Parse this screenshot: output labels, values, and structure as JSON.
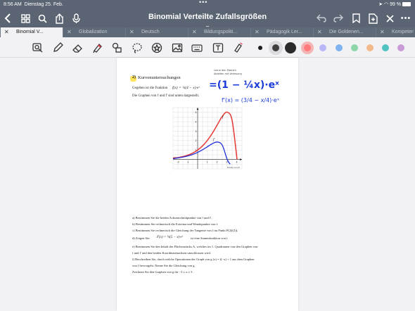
{
  "status": {
    "time": "8:56 AM",
    "date": "Dienstag 25. Feb.",
    "battery": "99 %"
  },
  "title_bar": {
    "document_title": "Binomial Verteilte Zufallsgrößen",
    "chevron": "chevron-down-icon"
  },
  "tabs": [
    {
      "label": "Binomial V...",
      "active": true
    },
    {
      "label": "Globalization",
      "active": false
    },
    {
      "label": "Deutsch",
      "active": false
    },
    {
      "label": "Bildungspoliti...",
      "active": false
    },
    {
      "label": "Pädagogik Ler...",
      "active": false
    },
    {
      "label": "Die Goldenen...",
      "active": false
    },
    {
      "label": "Kompeten...",
      "active": false
    }
  ],
  "pen_colors": [
    "#1c1c1e",
    "#404040",
    "#2b2b2b",
    "#ff7a7a",
    "#b9b7f5",
    "#7fb2f0",
    "#8ed6a8",
    "#f4b98a",
    "#4fc2c2",
    "#c89bd6"
  ],
  "page": {
    "task_number": "2)",
    "task_title": "Kurvenuntersuchungen",
    "margin_note_line1": "Lerne den Ebenen",
    "margin_note_line2": "Ableiten mit Vorlesung",
    "given_text": "Gegeben ist die Funktion",
    "function_def": "f(x) = ¼(4 − x)·eˣ",
    "handwritten_rewrite": "=(1 − ¼x)·eˣ",
    "graphs_text": "Die Graphen von f und f' sind unten dargestellt.",
    "handwritten_derivative": "f'(x) = (3/4 − x/4)·eˣ",
    "graph_label_f": "f",
    "graph_label_fprime": "f'",
    "x_ticks": [
      "-2",
      "-1",
      "1",
      "2",
      "3",
      "4"
    ],
    "y_ticks": [
      "5",
      "4",
      "3",
      "2",
      "1"
    ],
    "graph_caption": "Moodle.com.pdf",
    "tasks": [
      "a) Bestimmen Sie die beiden Achsenschnittpunkte von f und f'.",
      "b) Bestimmen Sie rechnerisch die Extrema und Wendepunkte von f.",
      "c) Bestimmen Sie rechnerisch die Gleichung der Tangente von f im Punkt P(2|f(2)).",
      "d) Zeigen Sie:",
      "e) Bestimmen Sie den Inhalt des Flächenstücks A, welches im 1. Quadranten von den Graphen von",
      "f und f' und den beiden Koordinatenachsen umschlossen wird.",
      "f) Beschreiben Sie, durch welche Operationen der Graph von g (x) = f(−x) + 1 aus dem Graphen",
      "von f hervorgeht. Nenne Sie die Gleichung von g.",
      "Zeichnen Sie den Graphen von g für   −3 ≤ x ≤ 3 ."
    ],
    "d_formula": "F(x) = ¼(5 − x)·eˣ",
    "d_suffix": "ist eine Stammfunktion von f."
  },
  "chart_data": {
    "type": "line",
    "title": "",
    "xlabel": "",
    "ylabel": "",
    "xlim": [
      -2.5,
      4.5
    ],
    "ylim": [
      -1,
      5.5
    ],
    "grid": true,
    "series": [
      {
        "name": "f",
        "color": "#e53935",
        "x": [
          -2.5,
          -2,
          -1.5,
          -1,
          -0.5,
          0,
          0.5,
          1,
          1.5,
          2,
          2.5,
          3,
          3.5,
          4
        ],
        "y": [
          0.17,
          0.2,
          0.31,
          0.46,
          0.68,
          1.0,
          1.44,
          2.04,
          2.8,
          3.69,
          4.57,
          5.02,
          4.14,
          0.0
        ]
      },
      {
        "name": "f'",
        "color": "#2230d8",
        "x": [
          -2.5,
          -2,
          -1.5,
          -1,
          -0.5,
          0,
          0.5,
          1,
          1.5,
          2,
          2.5,
          3,
          3.3
        ],
        "y": [
          0.07,
          0.17,
          0.25,
          0.37,
          0.53,
          0.75,
          1.03,
          1.36,
          1.68,
          1.85,
          1.52,
          0.0,
          -0.51
        ]
      }
    ]
  }
}
